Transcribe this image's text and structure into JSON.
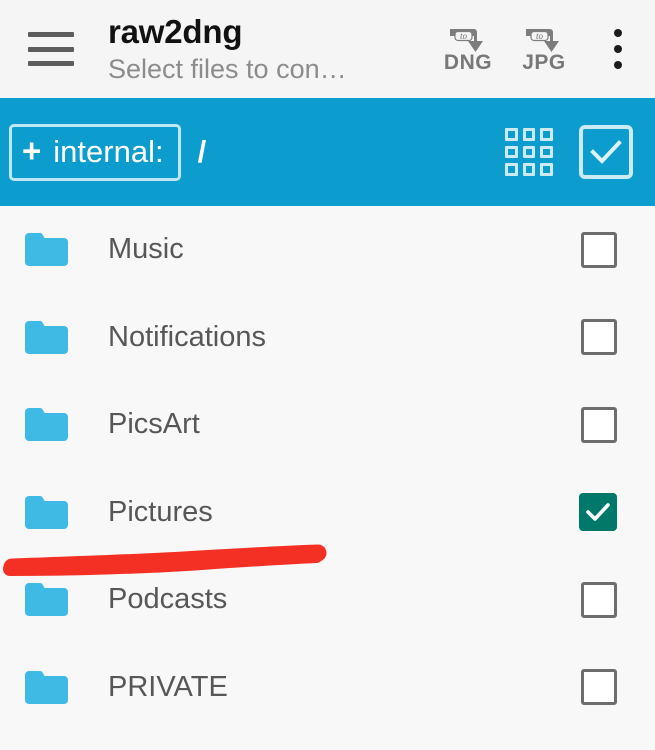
{
  "app_bar": {
    "menu_icon": "hamburger-icon",
    "title": "raw2dng",
    "subtitle": "Select files to con…",
    "actions": [
      {
        "icon": "convert-to-dng-icon",
        "small_label": "to",
        "label": "DNG"
      },
      {
        "icon": "convert-to-jpg-icon",
        "small_label": "to",
        "label": "JPG"
      }
    ],
    "overflow_icon": "more-vertical-icon"
  },
  "path_bar": {
    "storage_chip": {
      "plus": "+",
      "label": "internal:"
    },
    "path": "/",
    "grid_view_icon": "grid-view-icon",
    "select_all_icon": "select-all-checkbox-icon",
    "background_color": "#0c9cce"
  },
  "file_list": {
    "folder_color": "#3fbae4",
    "checked_color": "#00796b",
    "rows": [
      {
        "icon": "folder-icon",
        "name": "Music",
        "checked": false
      },
      {
        "icon": "folder-icon",
        "name": "Notifications",
        "checked": false
      },
      {
        "icon": "folder-icon",
        "name": "PicsArt",
        "checked": false
      },
      {
        "icon": "folder-icon",
        "name": "Pictures",
        "checked": true
      },
      {
        "icon": "folder-icon",
        "name": "Podcasts",
        "checked": false
      },
      {
        "icon": "folder-icon",
        "name": "PRIVATE",
        "checked": false
      }
    ]
  },
  "annotation": {
    "shape": "red-underline-stroke",
    "color": "#f43024"
  }
}
